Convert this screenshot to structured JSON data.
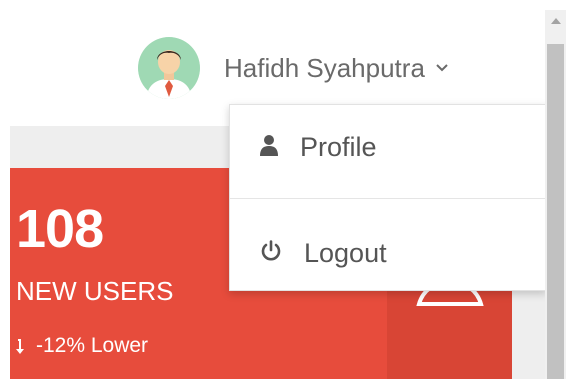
{
  "header": {
    "user_name": "Hafidh Syahputra",
    "avatar_icon": "user-avatar-icon",
    "chevron_icon": "chevron-down-icon"
  },
  "stat_card": {
    "value": "108",
    "label": "NEW USERS",
    "change_text": "-12% Lower",
    "change_icon": "arrow-down-icon",
    "icon": "user-outline-icon",
    "color": "#e74c3c"
  },
  "dropdown": {
    "items": [
      {
        "label": "Profile",
        "icon": "user-icon"
      },
      {
        "label": "Logout",
        "icon": "power-icon"
      }
    ]
  }
}
